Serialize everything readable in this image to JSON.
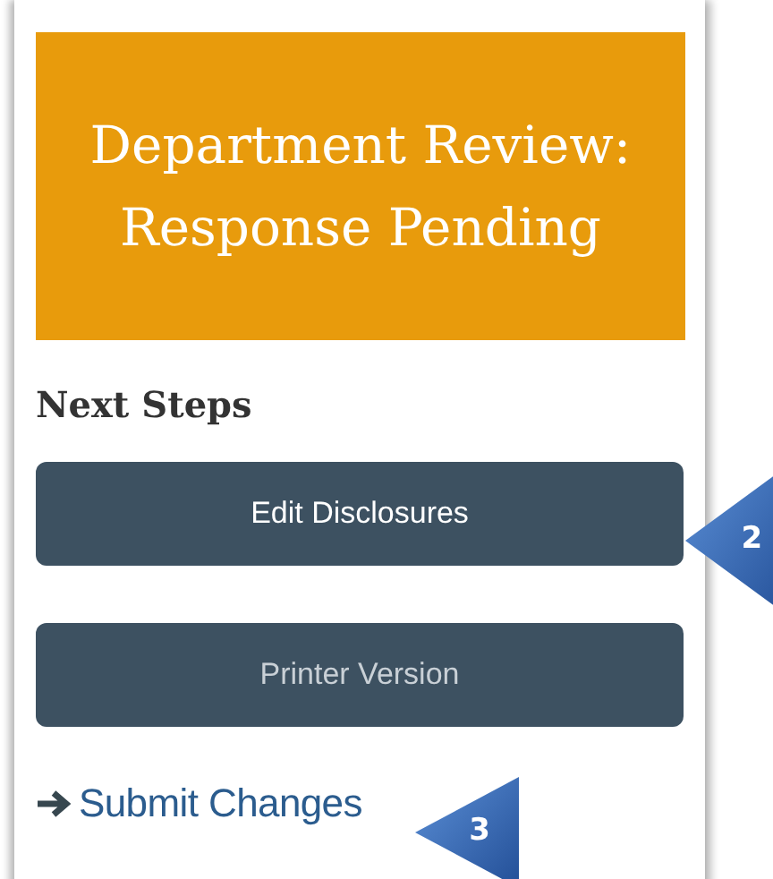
{
  "status_banner": {
    "text": "Department Review: Response Pending"
  },
  "next_steps": {
    "heading": "Next Steps",
    "buttons": [
      {
        "label": "Edit Disclosures",
        "callout": "2"
      },
      {
        "label": "Printer Version"
      }
    ],
    "links": [
      {
        "label": "Submit Changes",
        "callout": "3"
      }
    ]
  }
}
